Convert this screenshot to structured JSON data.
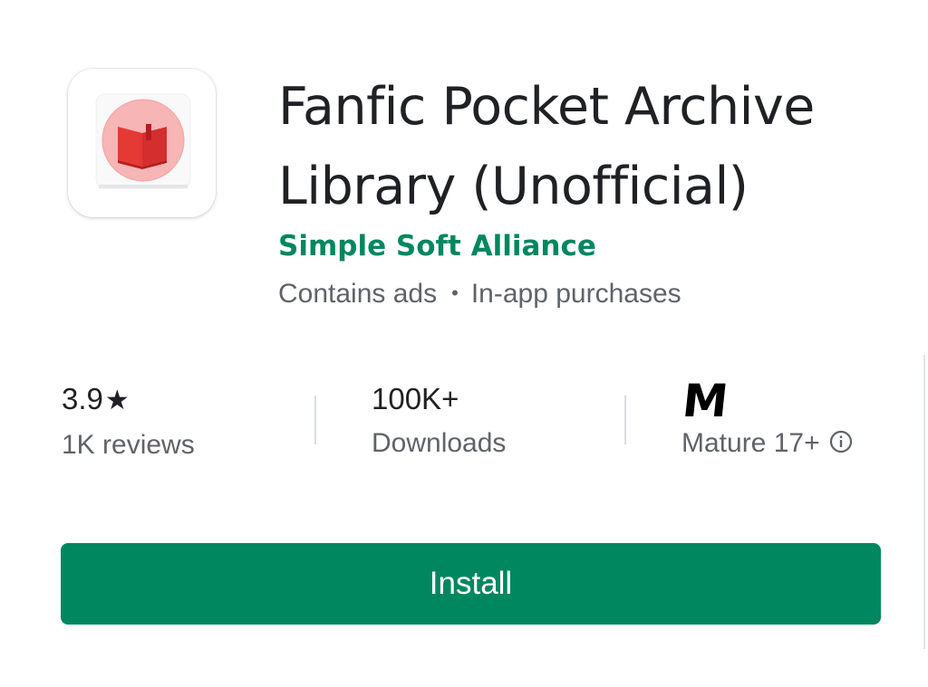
{
  "app": {
    "title": "Fanfic Pocket Archive Library (Unofficial)",
    "developer": "Simple Soft Alliance",
    "contains_ads": "Contains ads",
    "separator": "•",
    "in_app_purchases": "In-app purchases",
    "icon": "red-book-icon"
  },
  "stats": {
    "rating": {
      "value": "3.9",
      "star": "★",
      "label": "1K reviews"
    },
    "downloads": {
      "value": "100K+",
      "label": "Downloads"
    },
    "content_rating": {
      "badge": "M",
      "label": "Mature 17+",
      "info_icon": "info-icon"
    }
  },
  "install": {
    "label": "Install"
  },
  "colors": {
    "accent": "#01875f",
    "icon_red": "#e53935",
    "icon_circle": "#f8b4b4",
    "text_primary": "#202124",
    "text_secondary": "#5f6368"
  }
}
